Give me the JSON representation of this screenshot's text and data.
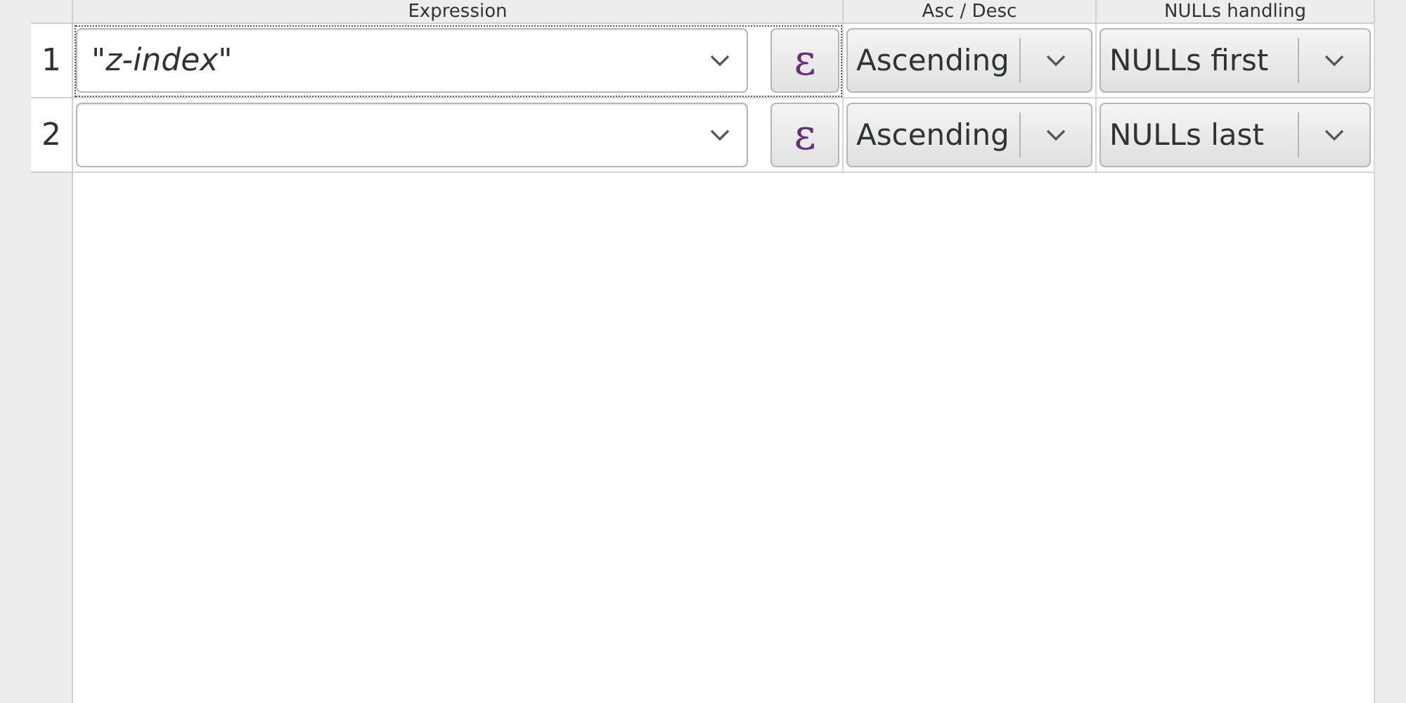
{
  "columns": [
    "Expression",
    "Asc / Desc",
    "NULLs handling"
  ],
  "rows": [
    {
      "number": "1",
      "expression": "\"z-index\"",
      "expression_button": "ε",
      "order": "Ascending",
      "nulls": "NULLs first",
      "selected": true
    },
    {
      "number": "2",
      "expression": "",
      "expression_button": "ε",
      "order": "Ascending",
      "nulls": "NULLs last",
      "selected": false
    }
  ]
}
